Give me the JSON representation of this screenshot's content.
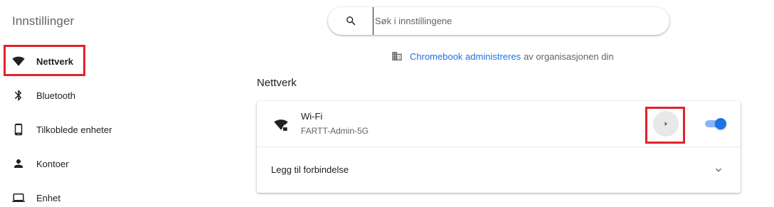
{
  "app": {
    "title": "Innstillinger"
  },
  "search": {
    "placeholder": "Søk i innstillingene"
  },
  "managed": {
    "link_text": "Chromebook administreres",
    "suffix": "av organisasjonen din"
  },
  "sidebar": {
    "items": [
      {
        "label": "Nettverk",
        "icon": "wifi-icon",
        "active": true
      },
      {
        "label": "Bluetooth",
        "icon": "bluetooth-icon",
        "active": false
      },
      {
        "label": "Tilkoblede enheter",
        "icon": "phone-icon",
        "active": false
      },
      {
        "label": "Kontoer",
        "icon": "person-icon",
        "active": false
      },
      {
        "label": "Enhet",
        "icon": "laptop-icon",
        "active": false
      }
    ]
  },
  "section": {
    "title": "Nettverk",
    "wifi": {
      "name": "Wi-Fi",
      "ssid": "FARTT-Admin-5G",
      "enabled": true
    },
    "add_connection": {
      "label": "Legg til forbindelse"
    }
  },
  "colors": {
    "accent": "#1a73e8",
    "toggle_track": "#8ab4f8",
    "highlight": "#e0242b",
    "secondary_text": "#5f6368"
  }
}
